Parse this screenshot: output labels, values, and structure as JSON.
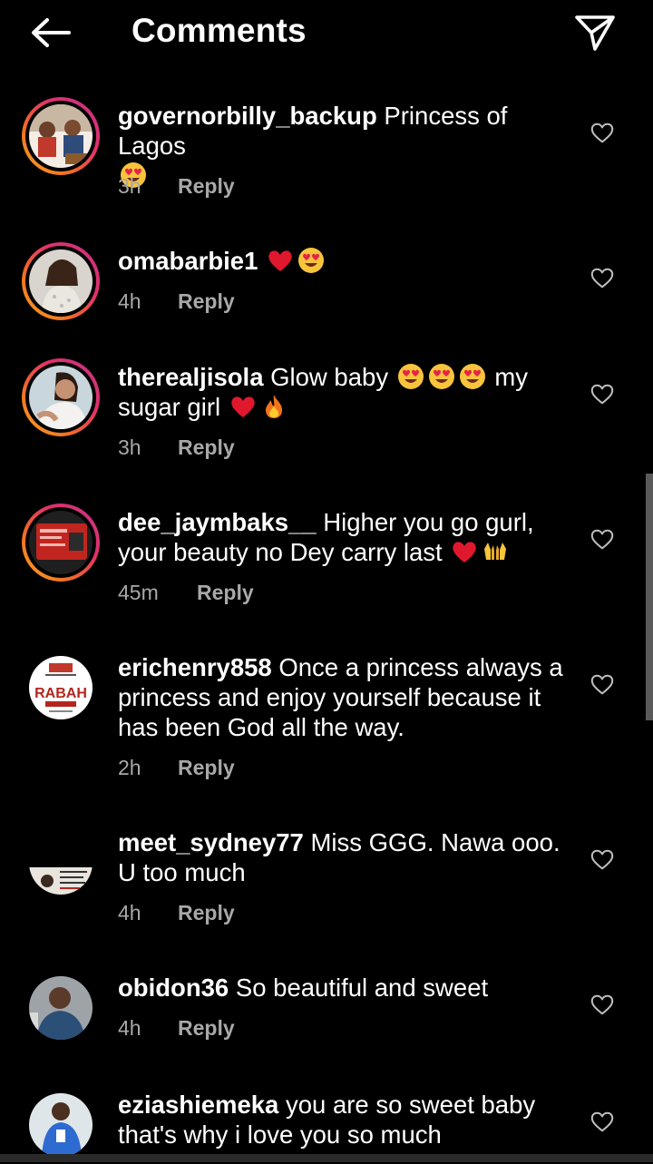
{
  "header": {
    "title": "Comments",
    "back_icon": "arrow-left-icon",
    "send_icon": "paper-plane-icon"
  },
  "reply_label": "Reply",
  "comments": [
    {
      "username": "governorbilly_backup",
      "text": "Princess of Lagos",
      "emojis": [
        "heart-eyes"
      ],
      "time": "3h",
      "reply": "Reply",
      "avatar_ring": true
    },
    {
      "username": "omabarbie1",
      "text": "",
      "emojis": [
        "red-heart",
        "heart-eyes"
      ],
      "time": "4h",
      "reply": "Reply",
      "avatar_ring": true
    },
    {
      "username": "therealjisola",
      "text": "Glow baby",
      "text2": "my",
      "text3": "sugar girl",
      "emojis": [
        "heart-eyes",
        "heart-eyes",
        "heart-eyes",
        "red-heart",
        "fire"
      ],
      "time": "3h",
      "reply": "Reply",
      "avatar_ring": true
    },
    {
      "username": "dee_jaymbaks__",
      "text": "Higher you go gurl,",
      "text2": "your beauty no Dey carry last",
      "emojis": [
        "red-heart",
        "raised-hands"
      ],
      "time": "45m",
      "reply": "Reply",
      "avatar_ring": true
    },
    {
      "username": "erichenry858",
      "text": "Once a princess always a princess and enjoy yourself because it has been God all the way.",
      "emojis": [],
      "time": "2h",
      "reply": "Reply",
      "avatar_ring": false,
      "avatar_text": "RABAH"
    },
    {
      "username": "meet_sydney77",
      "text": "Miss GGG. Nawa ooo. U too much",
      "emojis": [],
      "time": "4h",
      "reply": "Reply",
      "avatar_ring": false
    },
    {
      "username": "obidon36",
      "text": "So beautiful and sweet",
      "emojis": [],
      "time": "4h",
      "reply": "Reply",
      "avatar_ring": false
    },
    {
      "username": "eziashiemeka",
      "text": "you are so sweet baby that's why i love you so much",
      "emojis": [],
      "time": "",
      "reply": "",
      "avatar_ring": false
    }
  ],
  "colors": {
    "background": "#000000",
    "text": "#ffffff",
    "meta": "#a8a8a8",
    "story_ring_start": "#f9a826",
    "story_ring_end": "#c13584"
  }
}
